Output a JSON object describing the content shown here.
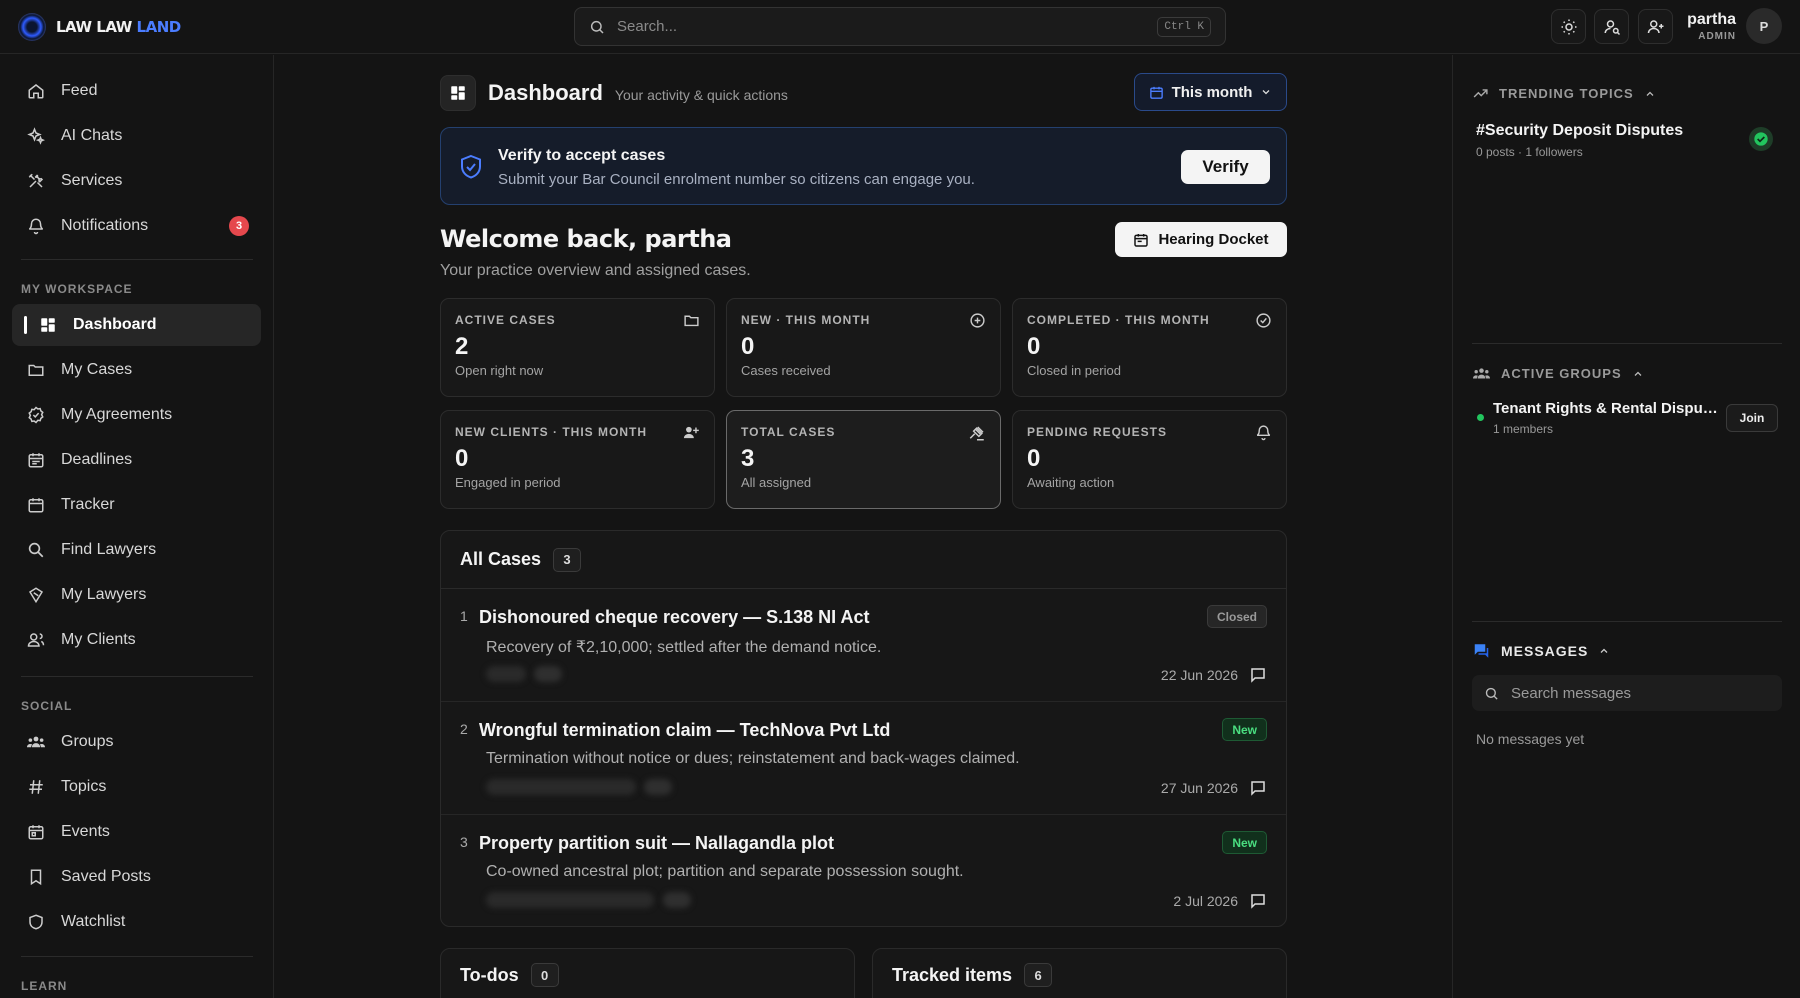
{
  "brand": {
    "name_part1": "LAW LAW ",
    "name_part2": "LAND",
    "accent_color": "#4b7dff"
  },
  "search": {
    "placeholder": "Search...",
    "shortcut": "Ctrl K"
  },
  "header_icons": [
    "sun-icon",
    "user-search-icon",
    "user-plus-icon"
  ],
  "user": {
    "name": "partha",
    "role": "ADMIN",
    "initial": "P"
  },
  "sidebar": {
    "items_top": [
      {
        "label": "Feed",
        "icon": "home-icon"
      },
      {
        "label": "AI Chats",
        "icon": "sparkles-icon"
      },
      {
        "label": "Services",
        "icon": "tools-icon"
      },
      {
        "label": "Notifications",
        "icon": "bell-icon",
        "badge": "3"
      }
    ],
    "workspace_label": "MY WORKSPACE",
    "workspace_items": [
      {
        "label": "Dashboard",
        "icon": "dashboard-icon",
        "active": true
      },
      {
        "label": "My Cases",
        "icon": "folder-icon"
      },
      {
        "label": "My Agreements",
        "icon": "badge-check-icon"
      },
      {
        "label": "Deadlines",
        "icon": "calendar-list-icon"
      },
      {
        "label": "Tracker",
        "icon": "calendar-grid-icon"
      },
      {
        "label": "Find Lawyers",
        "icon": "search-icon"
      },
      {
        "label": "My Lawyers",
        "icon": "gavel-badge-icon"
      },
      {
        "label": "My Clients",
        "icon": "users-icon"
      }
    ],
    "social_label": "SOCIAL",
    "social_items": [
      {
        "label": "Groups",
        "icon": "group-icon"
      },
      {
        "label": "Topics",
        "icon": "hash-icon"
      },
      {
        "label": "Events",
        "icon": "calendar-icon"
      },
      {
        "label": "Saved Posts",
        "icon": "bookmark-icon"
      },
      {
        "label": "Watchlist",
        "icon": "shield-icon"
      }
    ],
    "learn_label": "LEARN"
  },
  "dashboard": {
    "title": "Dashboard",
    "subtitle": "Your activity & quick actions",
    "period": "This month"
  },
  "verify": {
    "title": "Verify to accept cases",
    "subtitle": "Submit your Bar Council enrolment number so citizens can engage you.",
    "button": "Verify"
  },
  "welcome": {
    "title": "Welcome back, partha",
    "subtitle": "Your practice overview and assigned cases.",
    "docket_button": "Hearing Docket"
  },
  "stats": [
    {
      "label": "ACTIVE CASES",
      "value": "2",
      "sub": "Open right now",
      "icon": "folder-icon"
    },
    {
      "label": "NEW · THIS MONTH",
      "value": "0",
      "sub": "Cases received",
      "icon": "plus-circle-icon"
    },
    {
      "label": "COMPLETED · THIS MONTH",
      "value": "0",
      "sub": "Closed in period",
      "icon": "check-circle-icon"
    },
    {
      "label": "NEW CLIENTS · THIS MONTH",
      "value": "0",
      "sub": "Engaged in period",
      "icon": "user-plus-icon"
    },
    {
      "label": "TOTAL CASES",
      "value": "3",
      "sub": "All assigned",
      "icon": "gavel-icon",
      "highlight": true
    },
    {
      "label": "PENDING REQUESTS",
      "value": "0",
      "sub": "Awaiting action",
      "icon": "bell-icon"
    }
  ],
  "cases": {
    "title": "All Cases",
    "count": "3",
    "rows": [
      {
        "num": "1",
        "title": "Dishonoured cheque recovery — S.138 NI Act",
        "desc": "Recovery of ₹2,10,000; settled after the demand notice.",
        "status": "Closed",
        "status_kind": "closed",
        "date": "22 Jun 2026"
      },
      {
        "num": "2",
        "title": "Wrongful termination claim — TechNova Pvt Ltd",
        "desc": "Termination without notice or dues; reinstatement and back-wages claimed.",
        "status": "New",
        "status_kind": "new",
        "date": "27 Jun 2026"
      },
      {
        "num": "3",
        "title": "Property partition suit — Nallagandla plot",
        "desc": "Co-owned ancestral plot; partition and separate possession sought.",
        "status": "New",
        "status_kind": "new",
        "date": "2 Jul 2026"
      }
    ]
  },
  "todos": {
    "title": "To-dos",
    "count": "0"
  },
  "tracked": {
    "title": "Tracked items",
    "count": "6"
  },
  "right_panel": {
    "trending_label": "TRENDING TOPICS",
    "topic": {
      "title": "#Security Deposit Disputes",
      "meta": "0 posts · 1 followers"
    },
    "groups_label": "ACTIVE GROUPS",
    "group": {
      "title": "Tenant Rights & Rental Disputes",
      "meta": "1 members",
      "join": "Join"
    },
    "messages_label": "MESSAGES",
    "messages_search_placeholder": "Search messages",
    "messages_empty": "No messages yet"
  }
}
